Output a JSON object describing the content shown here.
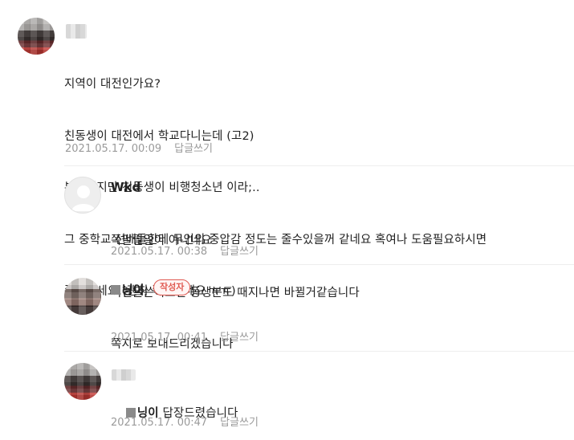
{
  "comments": [
    {
      "nickname": "",
      "lines": [
        "지역이 대전인가요?",
        "친동생이 대전에서 학교다니는데 (고2)",
        "부끄럽지만 친동생이 비행청소년 이라;..",
        "그 중학교 선배들한테 무언의 중압감 정도는 줄수있을꺼 같네요 혹여나 도움필요하시면",
        "쪽지주세요.(괜히 쪽팔리네요 ㅠㅠ)"
      ],
      "date": "2021.05.17. 00:09",
      "reply_label": "답글쓰기"
    }
  ],
  "replies": [
    {
      "nickname": "Wkd",
      "lines": [
        "쪽팔릴일이 아니네요",
        "이런글쓴이보면 동생분도 때지나면 바뀔거같습니다"
      ],
      "date": "2021.05.17. 00:38",
      "reply_label": "답글쓰기"
    },
    {
      "nickname": "닝이",
      "badge": "작성자",
      "lines": [
        "쪽지로 보내드리겠습니다"
      ],
      "date": "2021.05.17. 00:41",
      "reply_label": "답글쓰기"
    },
    {
      "nickname": "",
      "mention": "닝이",
      "text": "답장드렸습니다",
      "date": "2021.05.17. 00:47",
      "reply_label": "답글쓰기"
    }
  ]
}
